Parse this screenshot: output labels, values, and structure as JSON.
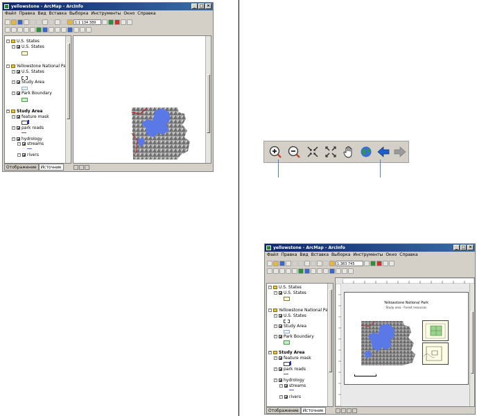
{
  "windows": {
    "small": {
      "title": "yellowstone - ArcMap - ArcInfo",
      "menus": [
        "Файл",
        "Правка",
        "Вид",
        "Вставка",
        "Выборка",
        "Инструменты",
        "Окно",
        "Справка"
      ],
      "scale": "1:1 134 389",
      "tabs": [
        "Отображение",
        "Источник"
      ]
    },
    "large": {
      "title": "yellowstone - ArcMap - ArcInfo",
      "menus": [
        "Файл",
        "Правка",
        "Вид",
        "Вставка",
        "Выборка",
        "Инструменты",
        "Окно",
        "Справка"
      ],
      "scale": "1:383 745",
      "tabs": [
        "Отображение",
        "Источник"
      ],
      "layout_title": "Yellowstone National Park",
      "layout_subtitle": "Study area - Forest resources"
    }
  },
  "toc": {
    "frame1": "U.S. States",
    "frame1_layer": "U.S. States",
    "frame2": "Yellowstone National Park",
    "frame2_layers": [
      "U.S. States",
      "Study Area",
      "Park Boundary"
    ],
    "frame3": "Study Area",
    "frame3_layers": [
      "feature mask",
      "park roads",
      "hydrology"
    ],
    "hydro_sub": [
      "streams",
      "rivers"
    ]
  },
  "colors": {
    "title_start": "#0a246a",
    "title_end": "#3a6ea5",
    "water": "#5a79e6",
    "callout": "#4a7fd0"
  },
  "icons": [
    "zoom-in-icon",
    "zoom-out-icon",
    "fixed-zoom-in-icon",
    "fixed-zoom-out-icon",
    "pan-icon",
    "full-extent-icon",
    "back-icon",
    "forward-icon"
  ]
}
